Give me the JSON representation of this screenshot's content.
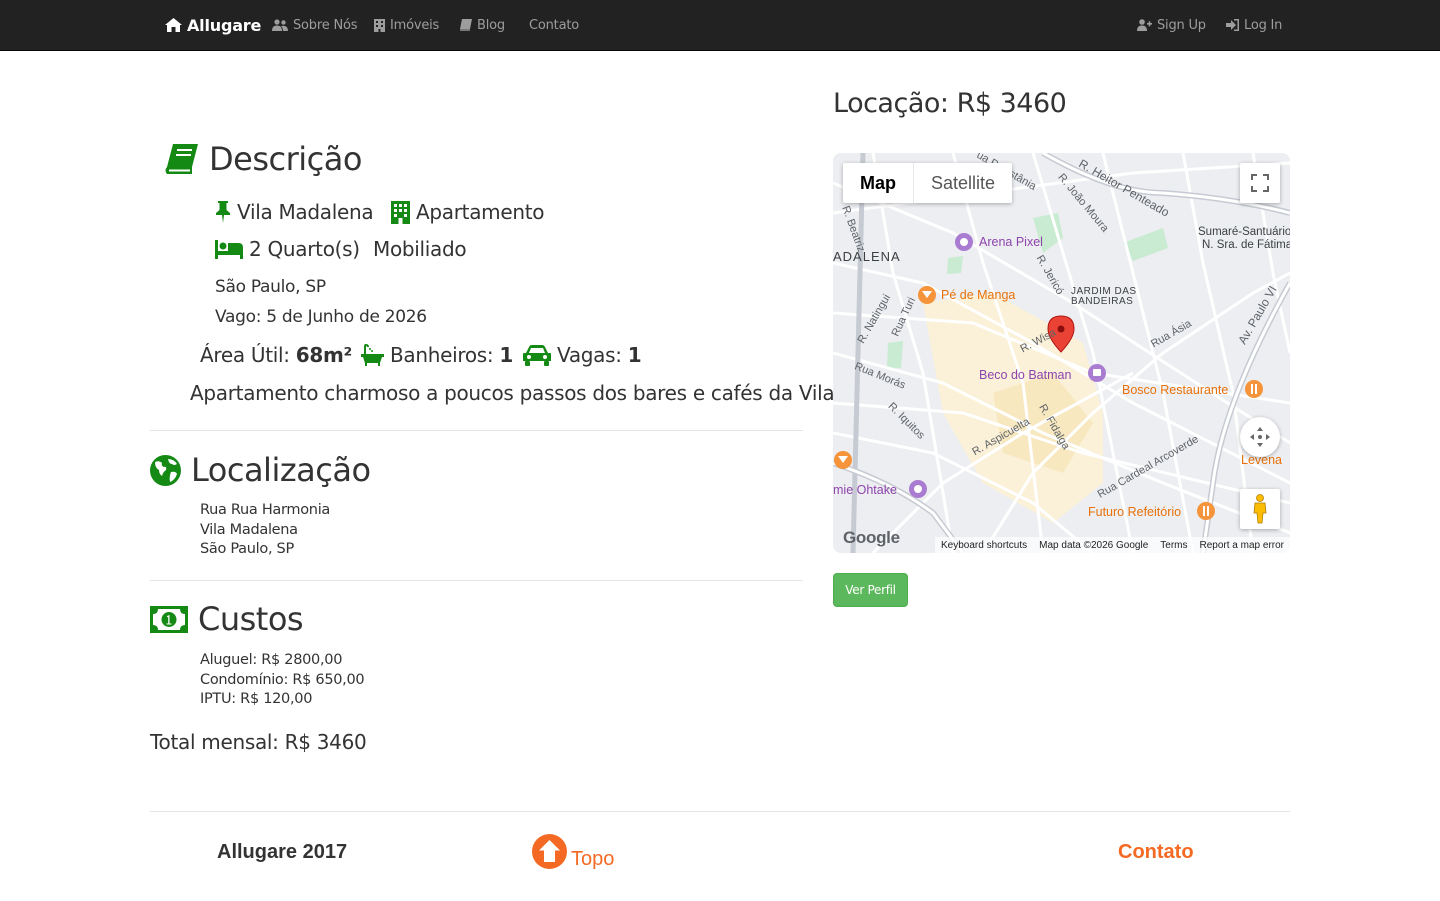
{
  "navbar": {
    "brand": "Allugare",
    "items": [
      {
        "label": "Sobre Nós",
        "icon": "users-icon"
      },
      {
        "label": "Imóveis",
        "icon": "building-icon"
      },
      {
        "label": "Blog",
        "icon": "book-icon"
      },
      {
        "label": "Contato",
        "icon": ""
      }
    ],
    "sign_up": "Sign Up",
    "log_in": "Log In"
  },
  "descricao": {
    "title": "Descrição",
    "bairro": "Vila Madalena",
    "tipo": "Apartamento",
    "quartos": "2 Quarto(s)",
    "mobiliado": "Mobiliado",
    "cidade": "São Paulo, SP",
    "vago": "Vago: 5 de Junho de 2026",
    "area_label": "Área Útil:",
    "area_value": "68m²",
    "banheiros_label": "Banheiros:",
    "banheiros_value": "1",
    "vagas_label": "Vagas:",
    "vagas_value": "1",
    "texto": "Apartamento charmoso a poucos passos dos bares e cafés da Vila."
  },
  "localizacao": {
    "title": "Localização",
    "rua": "Rua Rua Harmonia",
    "bairro": "Vila Madalena",
    "cidade": "São Paulo, SP"
  },
  "custos": {
    "title": "Custos",
    "aluguel": "Aluguel: R$ 2800,00",
    "condominio": "Condomínio: R$ 650,00",
    "iptu": "IPTU: R$ 120,00",
    "total": "Total mensal: R$ 3460"
  },
  "sidebar": {
    "price_title": "Locação: R$ 3460",
    "profile_button": "Ver Perfil"
  },
  "map": {
    "type_map": "Map",
    "type_satellite": "Satellite",
    "logo": "Google",
    "footer": {
      "shortcuts": "Keyboard shortcuts",
      "data": "Map data ©2026 Google",
      "terms": "Terms",
      "report": "Report a map error"
    },
    "labels": {
      "adalena": "ADALENA",
      "arena_pixel": "Arena Pixel",
      "pe_de_manga": "Pé de Manga",
      "jardim": "JARDIM DAS",
      "bandeiras": "BANDEIRAS",
      "sumare": "Sumaré-Santuário",
      "sumare2": "N. Sra. de Fátima",
      "beco": "Beco do Batman",
      "bosco": "Bosco Restaurante",
      "levena": "Levena",
      "ohtake": "mie Ohtake",
      "futuro": "Futuro Refeitório",
      "r_heitor": "R. Heitor Penteado",
      "r_joao_moura": "R. João Moura",
      "r_natingui": "R. Natingui",
      "rua_turi": "Rua Turi",
      "r_jerico": "R. Jericó",
      "r_wisard": "R. Wisa",
      "rua_asia": "Rua Ásia",
      "av_paulo_vi": "Av. Paulo VI",
      "rua_moras": "Rua Morás",
      "r_iquitos": "R. Iquitos",
      "r_aspicuelta": "R. Aspicuelta",
      "r_fidalga": "R. Fidalga",
      "rua_cardeal": "Rua Cardeal Arcoverde",
      "r_beatriz": "R. Beatriz",
      "r_distania": "ua Padistânia"
    }
  },
  "footer": {
    "brand": "Allugare 2017",
    "top": "Topo",
    "contact": "Contato"
  },
  "colors": {
    "navbar_bg": "#222222",
    "accent_green": "#148a14",
    "footer_orange": "#f46a24",
    "button_green": "#5cb85c"
  }
}
